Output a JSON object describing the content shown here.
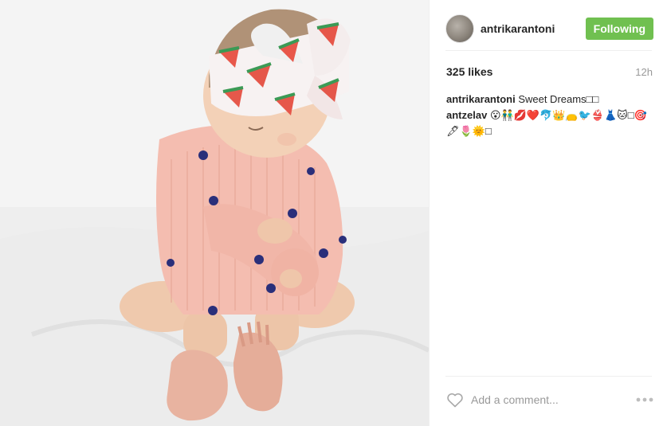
{
  "post": {
    "image_alt": "Baby in pink knit sweater with polka dots and watermelon headband",
    "username": "antrikarantoni",
    "follow_label": "Following",
    "likes": "325 likes",
    "time": "12h",
    "comments": [
      {
        "user": "antrikarantoni",
        "text": "Sweet Dreams□□"
      },
      {
        "user": "antzelav",
        "text": "😮👬💋❤️🐬👑👝🐦👙👗🐱□🎯🖋🌷🌞□"
      }
    ],
    "comment_placeholder": "Add a comment...",
    "icons": {
      "like": "heart-icon",
      "more": "more-options-icon"
    }
  },
  "colors": {
    "follow_button": "#70c050",
    "text_primary": "#262626",
    "text_muted": "#999999"
  }
}
